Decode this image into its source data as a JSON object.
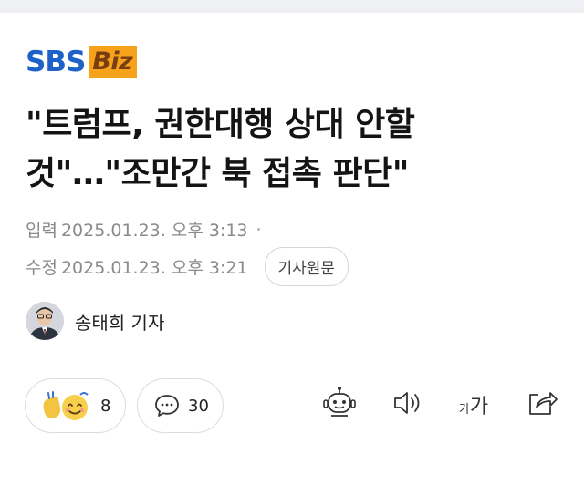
{
  "logo": {
    "part1": "SBS",
    "part2": "Biz"
  },
  "article": {
    "title_line1": "\"트럼프, 권한대행 상대 안할",
    "title_line2": "것\"…\"조만간 북 접촉 판단\""
  },
  "meta": {
    "published_label": "입력",
    "published_time": "2025.01.23. 오후 3:13",
    "modified_label": "수정",
    "modified_time": "2025.01.23. 오후 3:21",
    "original_button": "기사원문"
  },
  "reporter": {
    "name": "송태희 기자"
  },
  "reactions": {
    "count": "8",
    "icon": "clap-smile-emoji"
  },
  "comments": {
    "count": "30",
    "icon": "comment-bubble-icon"
  },
  "tools": [
    {
      "icon": "robot-summary-icon"
    },
    {
      "icon": "speaker-icon"
    },
    {
      "icon": "font-size-icon",
      "label_small": "가",
      "label_large": "가"
    },
    {
      "icon": "share-icon"
    }
  ]
}
